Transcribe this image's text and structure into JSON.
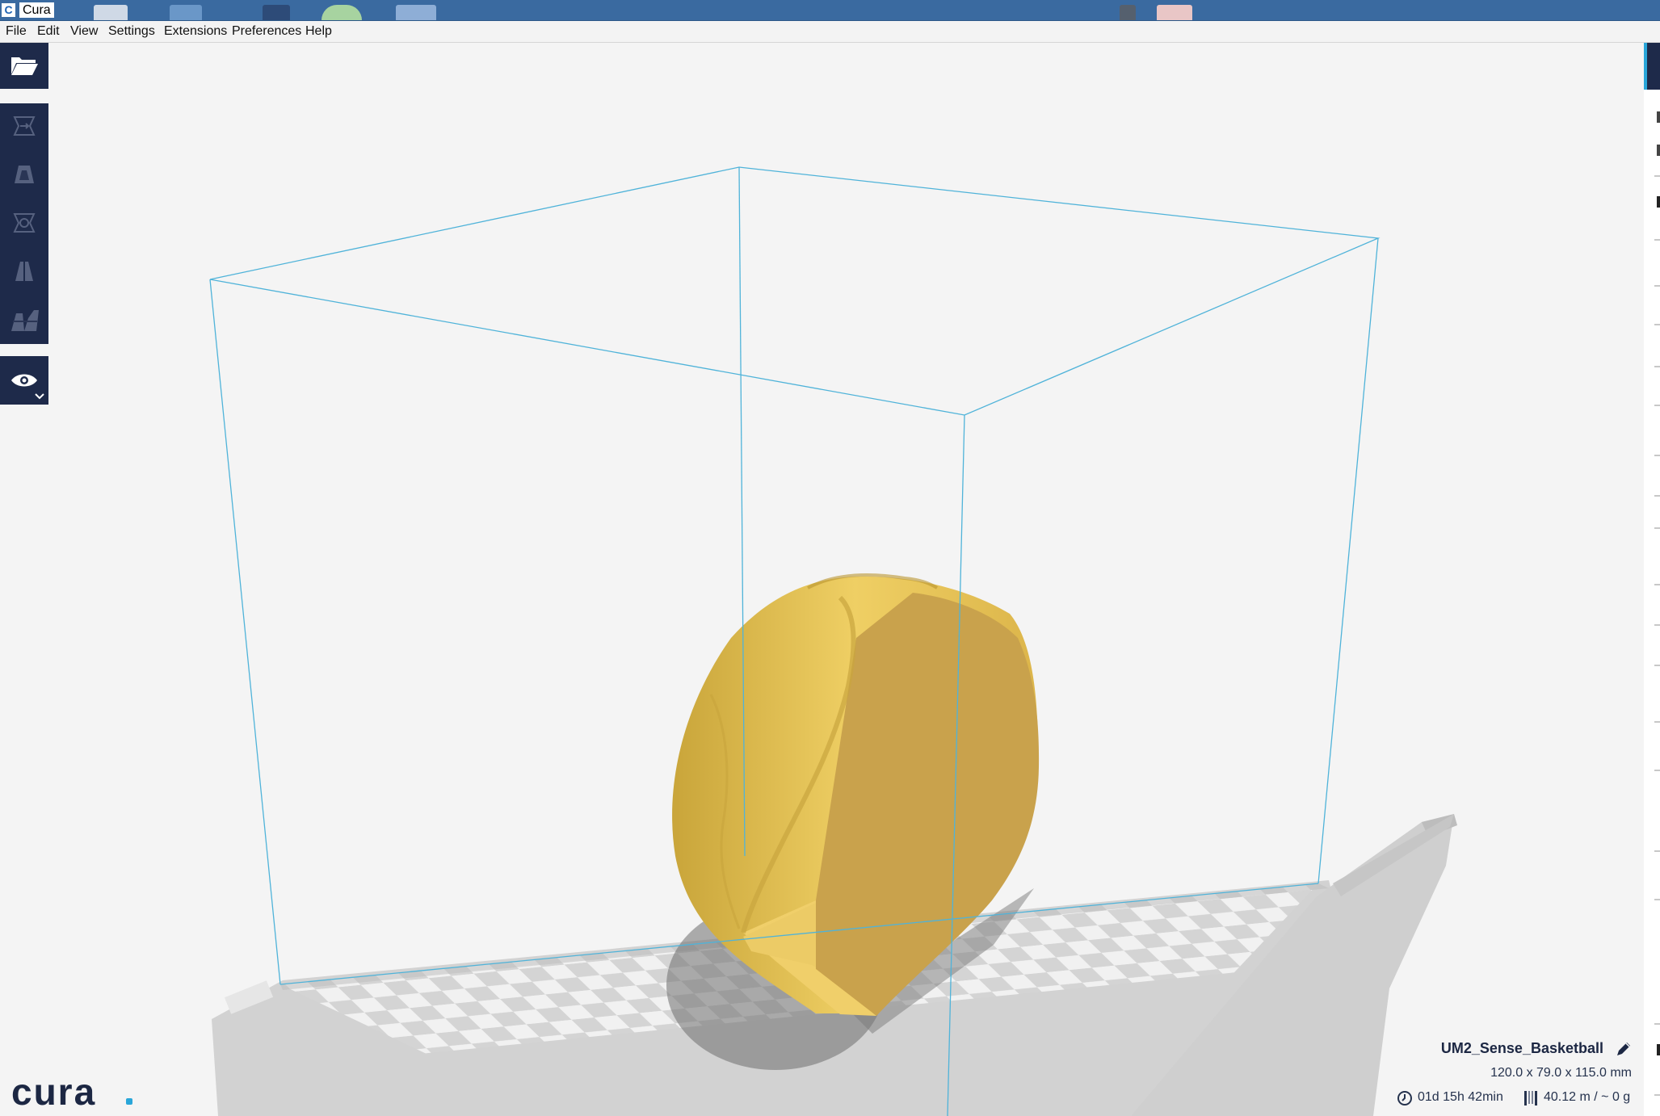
{
  "window": {
    "title": "Cura",
    "app_icon_letter": "C"
  },
  "menu": {
    "items": [
      "File",
      "Edit",
      "View",
      "Settings",
      "Extensions",
      "Preferences",
      "Help"
    ]
  },
  "toolbar": {
    "tools": [
      "open-file",
      "move",
      "scale",
      "rotate",
      "mirror",
      "per-model-settings",
      "view-mode"
    ]
  },
  "job": {
    "name": "UM2_Sense_Basketball",
    "dimensions": "120.0 x 79.0 x 115.0 mm",
    "print_time": "01d 15h 42min",
    "material": "40.12 m / ~ 0 g"
  },
  "brand": {
    "logo_text": "cura",
    "accent": "#29a6d9"
  },
  "colors": {
    "toolbar_bg": "#1e2a4a",
    "build_volume_outline": "#4fb3d9",
    "model": "#e8c55a",
    "title_bar": "#3a6aa0"
  }
}
